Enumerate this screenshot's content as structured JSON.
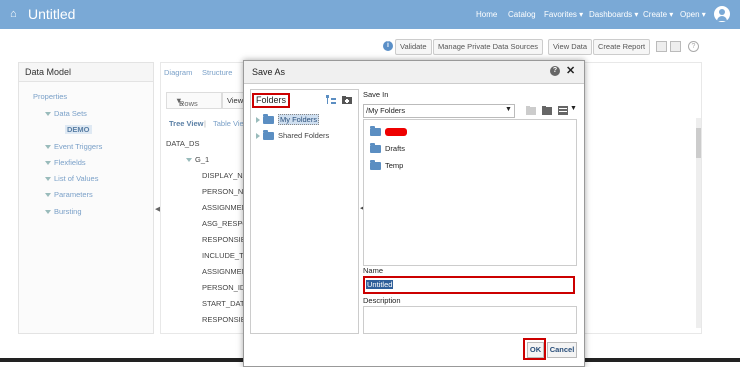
{
  "header": {
    "title": "Untitled",
    "nav": [
      "Home",
      "Catalog",
      "Favorites ▾",
      "Dashboards ▾",
      "Create ▾",
      "Open ▾"
    ]
  },
  "toolbar": {
    "validate": "Validate",
    "manage": "Manage Private Data Sources",
    "view_data": "View Data",
    "create_report": "Create Report"
  },
  "left_panel": {
    "title": "Data Model",
    "properties": "Properties",
    "data_sets": "Data Sets",
    "demo": "DEMO",
    "items": [
      "Event Triggers",
      "Flexfields",
      "List of Values",
      "Parameters",
      "Bursting"
    ]
  },
  "main": {
    "tabs": [
      "Diagram",
      "Structure"
    ],
    "rows_label": "Rows",
    "rows_value": "5",
    "view_label": "View",
    "tree_view": "Tree View",
    "table_view": "Table Vie",
    "tree_root": "DATA_DS",
    "group": "G_1",
    "fields": [
      "DISPLAY_NA",
      "PERSON_NU",
      "ASSIGNMEN",
      "ASG_RESPO",
      "RESPONSIB",
      "INCLUDE_TO",
      "ASSIGNMEN",
      "PERSON_ID",
      "START_DAT",
      "RESPONSIB"
    ]
  },
  "dialog": {
    "title": "Save As",
    "folders_label": "Folders",
    "folders": [
      "My Folders",
      "Shared Folders"
    ],
    "save_in_label": "Save In",
    "path": "/My Folders",
    "files": [
      "Drafts",
      "Temp"
    ],
    "name_label": "Name",
    "name_value": "Untitled",
    "description_label": "Description",
    "ok": "OK",
    "cancel": "Cancel"
  }
}
